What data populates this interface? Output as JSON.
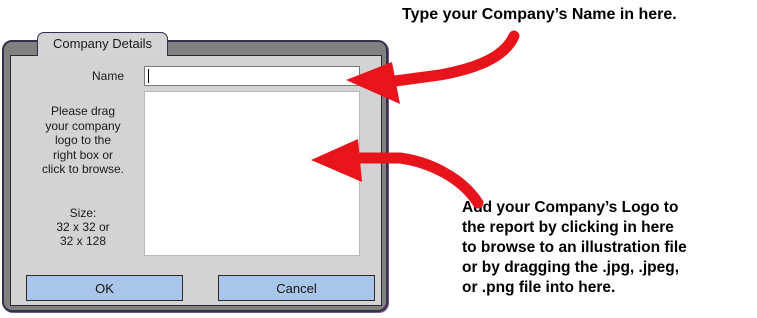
{
  "dialog": {
    "title": "Company Details",
    "name_label": "Name",
    "name_value": "",
    "instructions": "Please drag\nyour company\nlogo to the\nright box or\nclick to browse.",
    "size_info": "Size:\n32 x 32 or\n32 x 128",
    "ok_label": "OK",
    "cancel_label": "Cancel"
  },
  "annotations": {
    "name_callout": "Type your Company’s Name in here.",
    "logo_callout": "Add your Company’s Logo to\nthe report by clicking in here\nto browse to an illustration file\nor by dragging the .jpg, .jpeg,\nor .png file into here.",
    "arrow_color": "#e8141c"
  },
  "colors": {
    "dialog_frame": "#818181",
    "panel": "#d3d3d3",
    "button": "#a9c6ea"
  }
}
